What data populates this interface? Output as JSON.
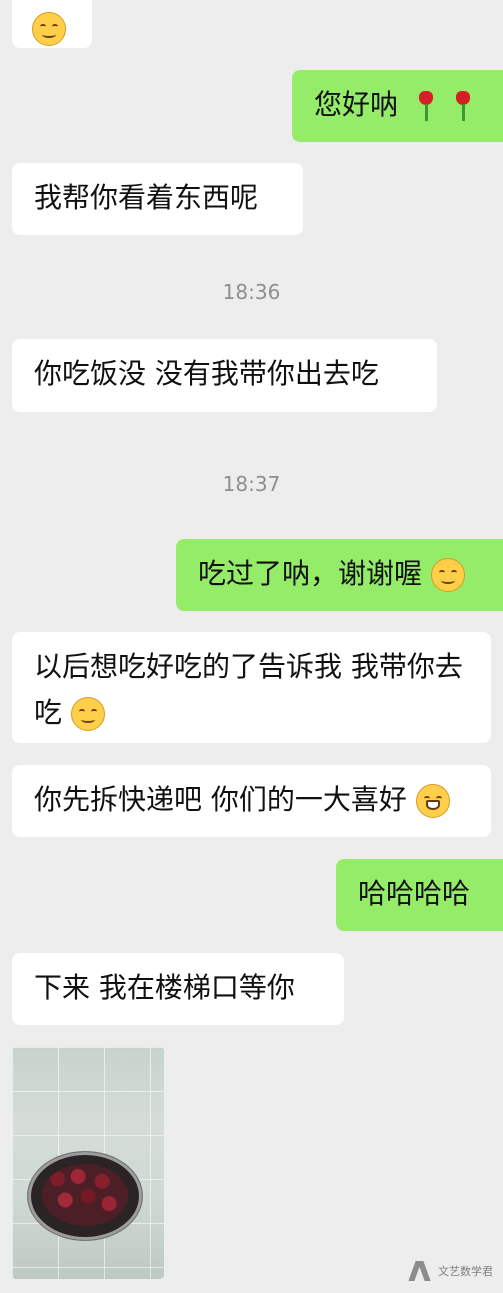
{
  "chat": {
    "timestamps": [
      "18:36",
      "18:37"
    ],
    "messages": [
      {
        "text": "",
        "emoji": [
          "smile-face-icon"
        ]
      },
      {
        "text": "您好呐",
        "emoji": [
          "rose-icon",
          "rose-icon"
        ]
      },
      {
        "text": "我帮你看着东西呢"
      },
      {
        "text": "你吃饭没 没有我带你出去吃"
      },
      {
        "text": "吃过了呐，谢谢喔",
        "emoji": [
          "happy-face-icon"
        ]
      },
      {
        "text": "以后想吃好吃的了告诉我 我带你去吃",
        "emoji": [
          "sleepy-face-icon"
        ]
      },
      {
        "text": "你先拆快递吧 你们的一大喜好",
        "emoji": [
          "grin-face-icon"
        ]
      },
      {
        "text": "哈哈哈哈"
      },
      {
        "text": "下来 我在楼梯口等你"
      }
    ]
  },
  "watermark": {
    "text": "文艺数学君"
  },
  "colors": {
    "background": "#ededed",
    "incoming_bubble": "#ffffff",
    "outgoing_bubble": "#95ec69",
    "timestamp": "#8e8e8e"
  }
}
